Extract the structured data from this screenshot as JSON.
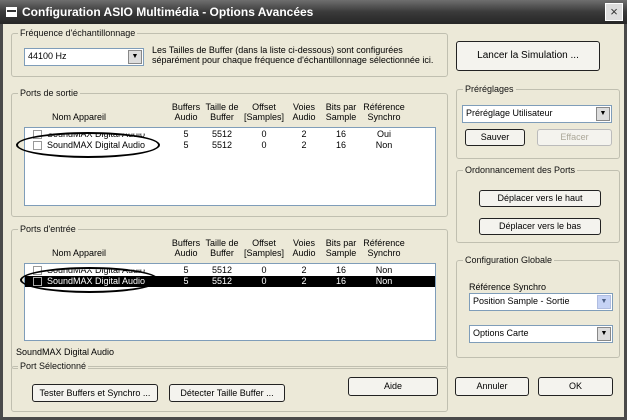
{
  "window": {
    "title": "Configuration ASIO Multimédia  - Options Avancées",
    "close_symbol": "×"
  },
  "sample_rate": {
    "legend": "Fréquence d'échantillonnage",
    "value": "44100 Hz",
    "note_line1": "Les Tailles de Buffer (dans la liste ci-dessous) sont configurées",
    "note_line2": "séparément pour chaque fréquence d'échantillonnage sélectionnée ici."
  },
  "simulation_button": "Lancer la Simulation ...",
  "columns": {
    "name": "Nom Appareil",
    "buffers": [
      "Buffers",
      "Audio"
    ],
    "buffer_size": [
      "Taille de",
      "Buffer"
    ],
    "offset": [
      "Offset",
      "[Samples]"
    ],
    "channels": [
      "Voies",
      "Audio"
    ],
    "bits": [
      "Bits par",
      "Sample"
    ],
    "sync": [
      "Référence",
      "Synchro"
    ]
  },
  "output_ports": {
    "legend": "Ports de sortie",
    "rows": [
      {
        "name": "SoundMAX Digital Audio",
        "buffers": "5",
        "buffer_size": "5512",
        "offset": "0",
        "channels": "2",
        "bits": "16",
        "sync": "Oui"
      },
      {
        "name": "SoundMAX Digital Audio",
        "buffers": "5",
        "buffer_size": "5512",
        "offset": "0",
        "channels": "2",
        "bits": "16",
        "sync": "Non"
      }
    ]
  },
  "input_ports": {
    "legend": "Ports d'entrée",
    "rows": [
      {
        "name": "SoundMAX Digital Audio",
        "buffers": "5",
        "buffer_size": "5512",
        "offset": "0",
        "channels": "2",
        "bits": "16",
        "sync": "Non"
      },
      {
        "name": "SoundMAX Digital Audio",
        "buffers": "5",
        "buffer_size": "5512",
        "offset": "0",
        "channels": "2",
        "bits": "16",
        "sync": "Non"
      }
    ],
    "selected_label": "SoundMAX Digital Audio"
  },
  "presets": {
    "legend": "Préréglages",
    "value": "Préréglage Utilisateur",
    "save": "Sauver",
    "delete": "Effacer"
  },
  "port_order": {
    "legend": "Ordonnancement des Ports",
    "up": "Déplacer vers le haut",
    "down": "Déplacer vers le bas"
  },
  "global_config": {
    "legend": "Configuration Globale",
    "sync_label": "Référence Synchro",
    "sync_value": "Position Sample - Sortie",
    "card_value": "Options Carte"
  },
  "selected_port": {
    "legend": "Port Sélectionné",
    "test": "Tester Buffers et Synchro ...",
    "detect": "Détecter Taille Buffer ..."
  },
  "footer": {
    "help": "Aide",
    "cancel": "Annuler",
    "ok": "OK"
  }
}
